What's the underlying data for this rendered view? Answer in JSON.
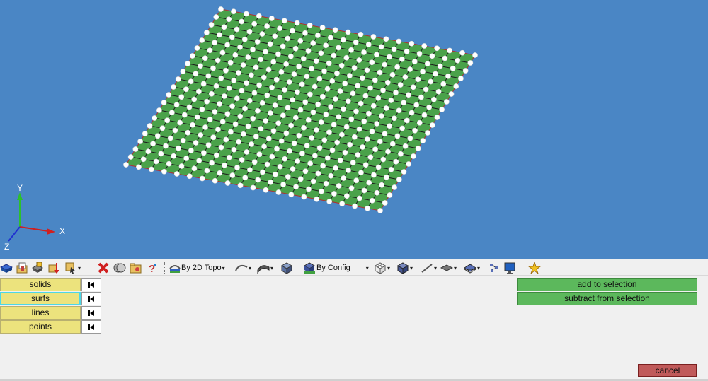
{
  "viewport": {
    "background_color": "#4a86c5",
    "mesh_color": "#4aa24a",
    "axis_labels": {
      "x": "X",
      "y": "Y",
      "z": "Z"
    }
  },
  "toolbar": {
    "icons": [
      "solids-icon",
      "new-folder-icon",
      "save-icon",
      "download-icon",
      "select-icon",
      "delete-icon",
      "surfaces-icon",
      "folder-icon",
      "help-icon",
      "topo-icon",
      "curve-icon",
      "surface-icon",
      "cube-icon",
      "config-icon",
      "wireframe-icon",
      "shaded-icon",
      "line-icon",
      "plane-icon",
      "layer-icon",
      "network-icon",
      "monitor-icon",
      "star-icon"
    ],
    "topo_dropdown": "By 2D Topo",
    "config_dropdown": "By Config"
  },
  "selection_panel": {
    "entities": [
      {
        "label": "solids",
        "active": false
      },
      {
        "label": "surfs",
        "active": true
      },
      {
        "label": "lines",
        "active": false
      },
      {
        "label": "points",
        "active": false
      }
    ],
    "add_label": "add to selection",
    "subtract_label": "subtract from selection",
    "cancel_label": "cancel"
  }
}
